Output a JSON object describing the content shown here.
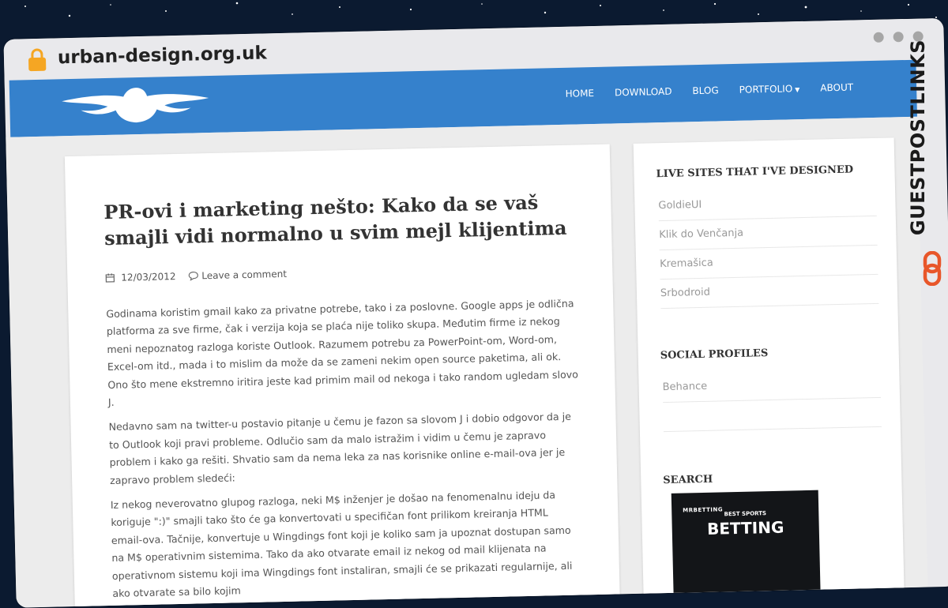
{
  "browser": {
    "url": "urban-design.org.uk"
  },
  "nav": {
    "items": [
      {
        "label": "HOME"
      },
      {
        "label": "DOWNLOAD"
      },
      {
        "label": "BLOG"
      },
      {
        "label": "PORTFOLIO"
      },
      {
        "label": "ABOUT"
      }
    ]
  },
  "post": {
    "title": "PR-ovi i marketing nešto: Kako da se vaš smajli vidi normalno u svim mejl klijentima",
    "date": "12/03/2012",
    "comment_link": "Leave a comment",
    "paragraphs": [
      "Godinama koristim gmail kako za privatne potrebe, tako i za poslovne. Google apps je odlična platforma za sve firme, čak i verzija koja se plaća nije toliko skupa. Međutim firme iz nekog meni nepoznatog razloga koriste Outlook. Razumem potrebu za PowerPoint-om, Word-om, Excel-om itd., mada i to mislim da može da se zameni nekim open source paketima, ali ok. Ono što mene ekstremno iritira jeste kad primim mail od nekoga i tako random ugledam slovo J.",
      "Nedavno sam na twitter-u postavio pitanje u čemu je fazon sa slovom J i dobio odgovor da je to Outlook koji pravi probleme. Odlučio sam da malo istražim i vidim u čemu je zapravo problem i kako ga rešiti. Shvatio sam da nema leka za nas korisnike online e-mail-ova jer je zapravo problem sledeći:",
      "Iz nekog neverovatno glupog razloga, neki M$ inženjer je došao na fenomenalnu ideju da koriguje \":)\" smajli tako što će ga konvertovati u specifičan font prilikom kreiranja HTML email-ova. Tačnije, konvertuje u Wingdings font koji je koliko sam ja upoznat dostupan samo na M$ operativnim sistemima. Tako da ako otvarate email iz nekog od mail klijenata na operativnom sistemu koji ima Wingdings font instaliran, smajli će se prikazati regularnije, ali ako otvarate sa bilo kojim"
    ]
  },
  "sidebar": {
    "live_sites_title": "LIVE SITES THAT I'VE DESIGNED",
    "live_sites": [
      "GoldieUI",
      "Klik do Venčanja",
      "Kremašica",
      "Srbodroid"
    ],
    "social_title": "SOCIAL PROFILES",
    "social": [
      "Behance"
    ],
    "search_title": "SEARCH",
    "ad": {
      "brand": "MRBETTING",
      "tagline": "BEST SPORTS",
      "headline": "BETTING"
    }
  },
  "watermark": {
    "text": "GUESTPOSTLINKS"
  },
  "colors": {
    "nav": "#3581cc",
    "page_bg": "#ececec",
    "space_bg": "#0b1a30",
    "watermark_accent": "#e8562a"
  }
}
